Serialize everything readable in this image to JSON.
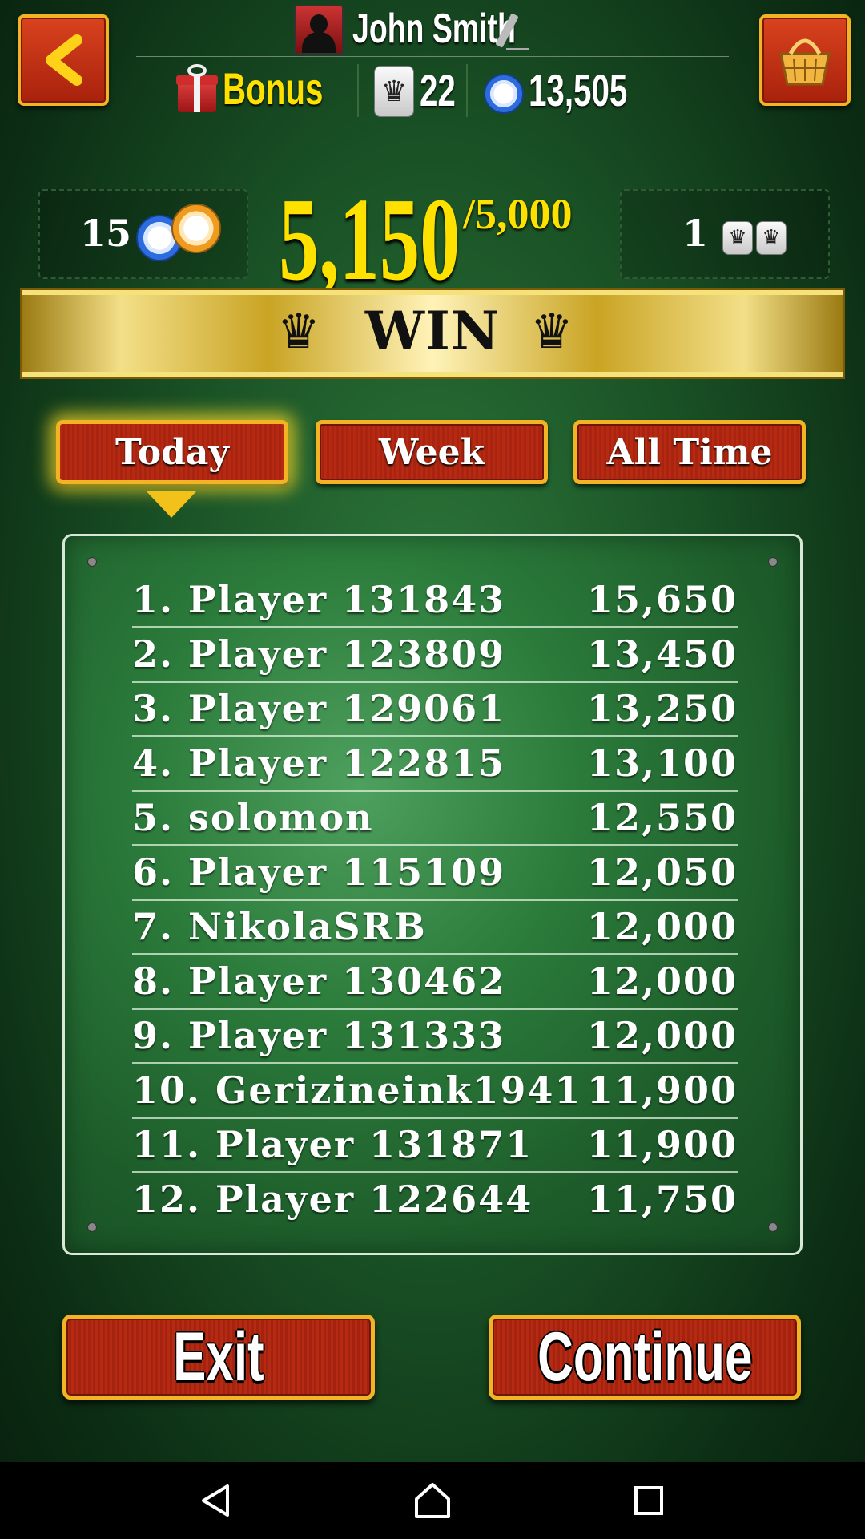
{
  "header": {
    "username": "John Smith",
    "bonus_label": "Bonus",
    "queens_count": "22",
    "chips_balance": "13,505"
  },
  "score": {
    "chips_count": "15",
    "current": "5,150",
    "target": "/5,000",
    "wins_count": "1"
  },
  "result": {
    "banner_text": "WIN"
  },
  "tabs": [
    {
      "label": "Today",
      "active": true
    },
    {
      "label": "Week",
      "active": false
    },
    {
      "label": "All Time",
      "active": false
    }
  ],
  "leaderboard": [
    {
      "name": "1. Player 131843",
      "score": "15,650"
    },
    {
      "name": "2. Player 123809",
      "score": "13,450"
    },
    {
      "name": "3. Player 129061",
      "score": "13,250"
    },
    {
      "name": "4. Player 122815",
      "score": "13,100"
    },
    {
      "name": "5. solomon",
      "score": "12,550"
    },
    {
      "name": "6. Player 115109",
      "score": "12,050"
    },
    {
      "name": "7. NikolaSRB",
      "score": "12,000"
    },
    {
      "name": "8. Player 130462",
      "score": "12,000"
    },
    {
      "name": "9. Player 131333",
      "score": "12,000"
    },
    {
      "name": "10. Gerizineink1941",
      "score": "11,900"
    },
    {
      "name": "11. Player 131871",
      "score": "11,900"
    },
    {
      "name": "12. Player 122644",
      "score": "11,750"
    }
  ],
  "buttons": {
    "exit_label": "Exit",
    "continue_label": "Continue"
  },
  "icons": {
    "back": "chevron-left-icon",
    "shop": "basket-icon",
    "gift": "gift-icon",
    "queen": "queen-crown-icon",
    "chip": "poker-chip-icon",
    "nav_back": "triangle-back-icon",
    "nav_home": "home-icon",
    "nav_recents": "square-recents-icon"
  },
  "colors": {
    "accent_gold": "#ffe100",
    "button_red": "#b52a10",
    "border_gold": "#f2b324",
    "table_green": "#2b7b3b"
  }
}
